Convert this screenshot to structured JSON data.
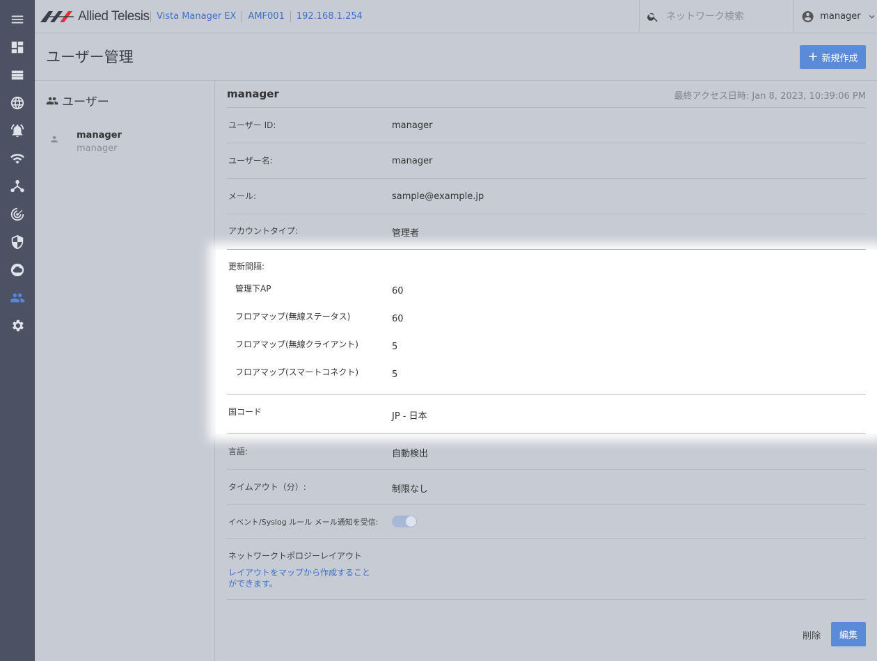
{
  "app": {
    "logo_text": "Allied Telesis",
    "breadcrumbs": [
      "Vista Manager EX",
      "AMF001",
      "192.168.1.254"
    ]
  },
  "search": {
    "placeholder": "ネットワーク検索"
  },
  "user_menu": {
    "name": "manager"
  },
  "sidebar": {
    "icons": [
      "menu-icon",
      "dashboard-icon",
      "list-icon",
      "globe-icon",
      "alarm-bell-icon",
      "wifi-icon",
      "topology-icon",
      "radar-icon",
      "shield-icon",
      "cloud-icon",
      "users-icon",
      "settings-icon"
    ],
    "active": "users-icon"
  },
  "page": {
    "title": "ユーザー管理",
    "new_button": "新規作成"
  },
  "user_list": {
    "heading": "ユーザー",
    "items": [
      {
        "name": "manager",
        "username": "manager"
      }
    ]
  },
  "detail": {
    "title": "manager",
    "last_access": "最終アクセス日時: Jan 8, 2023, 10:39:06 PM",
    "user_id_label": "ユーザー ID:",
    "user_id": "manager",
    "user_name_label": "ユーザー名:",
    "user_name": "manager",
    "email_label": "メール:",
    "email": "sample@example.jp",
    "account_type_label": "アカウントタイプ:",
    "account_type": "管理者",
    "refresh": {
      "label": "更新間隔:",
      "items": [
        {
          "label": "管理下AP",
          "value": "60"
        },
        {
          "label": "フロアマップ(無線ステータス)",
          "value": "60"
        },
        {
          "label": "フロアマップ(無線クライアント)",
          "value": "5"
        },
        {
          "label": "フロアマップ(スマートコネクト)",
          "value": "5"
        }
      ]
    },
    "country_label": "国コード",
    "country": "JP - 日本",
    "language_label": "言語:",
    "language": "自動検出",
    "timeout_label": "タイムアウト（分）:",
    "timeout": "制限なし",
    "notify_label": "イベント/Syslog ルール メール通知を受信:",
    "notify_enabled": true,
    "topology_label": "ネットワークトポロジーレイアウト",
    "topology_link": "レイアウトをマップから作成することができます。"
  },
  "actions": {
    "delete": "削除",
    "edit": "編集"
  },
  "colors": {
    "sidebar": "#4c5264",
    "accent": "#5b8ad8",
    "background": "#c7cbd3"
  }
}
